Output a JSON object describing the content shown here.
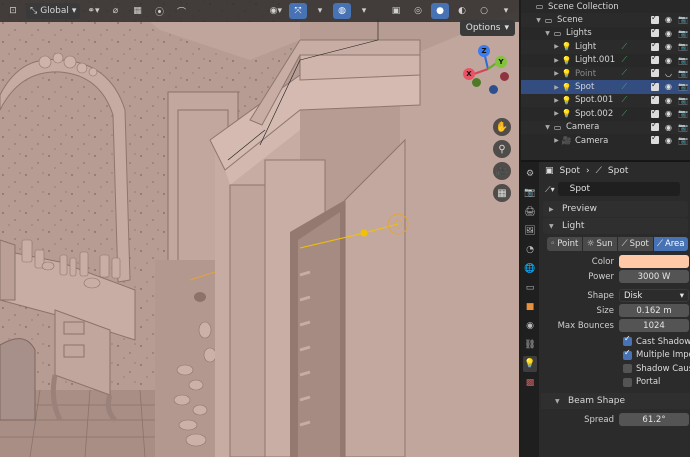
{
  "viewport_header": {
    "orientation_label": "Global",
    "options_label": "Options"
  },
  "gizmo": {
    "z_label": "Z",
    "y_label": "Y",
    "x_label": "X"
  },
  "outliner": {
    "rows": [
      {
        "label": "Scene Collection",
        "indent": 0,
        "icon": "collection-icon",
        "arrow": "",
        "selected": false
      },
      {
        "label": "Scene",
        "indent": 1,
        "icon": "collection-icon",
        "arrow": "▼",
        "selected": false
      },
      {
        "label": "Lights",
        "indent": 2,
        "icon": "collection-icon",
        "arrow": "▼",
        "selected": false
      },
      {
        "label": "Light",
        "indent": 3,
        "icon": "light-icon",
        "arrow": "▶",
        "selected": false
      },
      {
        "label": "Light.001",
        "indent": 3,
        "icon": "light-icon",
        "arrow": "▶",
        "selected": false
      },
      {
        "label": "Point",
        "indent": 3,
        "icon": "light-icon",
        "arrow": "▶",
        "selected": false,
        "dim": true
      },
      {
        "label": "Spot",
        "indent": 3,
        "icon": "light-icon",
        "arrow": "▶",
        "selected": true
      },
      {
        "label": "Spot.001",
        "indent": 3,
        "icon": "light-icon",
        "arrow": "▶",
        "selected": false
      },
      {
        "label": "Spot.002",
        "indent": 3,
        "icon": "light-icon",
        "arrow": "▶",
        "selected": false
      },
      {
        "label": "Camera",
        "indent": 2,
        "icon": "collection-icon",
        "arrow": "▼",
        "selected": false
      },
      {
        "label": "Camera",
        "indent": 3,
        "icon": "camera-icon",
        "arrow": "▶",
        "selected": false
      }
    ]
  },
  "properties": {
    "breadcrumb_object": "Spot",
    "breadcrumb_data": "Spot",
    "data_name": "Spot",
    "preview_label": "Preview",
    "light_label": "Light",
    "light_types": [
      {
        "label": "Point",
        "active": false
      },
      {
        "label": "Sun",
        "active": false
      },
      {
        "label": "Spot",
        "active": false
      },
      {
        "label": "Area",
        "active": true
      }
    ],
    "color_label": "Color",
    "color_value": "#ffc9a8",
    "power_label": "Power",
    "power_value": "3000 W",
    "shape_label": "Shape",
    "shape_value": "Disk",
    "size_label": "Size",
    "size_value": "0.162 m",
    "max_bounces_label": "Max Bounces",
    "max_bounces_value": "1024",
    "checkboxes": [
      {
        "label": "Cast Shadow",
        "checked": true
      },
      {
        "label": "Multiple Impor...",
        "checked": true
      },
      {
        "label": "Shadow Caust...",
        "checked": false
      },
      {
        "label": "Portal",
        "checked": false
      }
    ],
    "beam_shape_label": "Beam Shape",
    "spread_label": "Spread",
    "spread_value": "61.2°"
  },
  "colors": {
    "accent": "#4772b3",
    "selection": "#334d80",
    "wall": "#b69b92",
    "light_gizmo": "#f2c200"
  }
}
